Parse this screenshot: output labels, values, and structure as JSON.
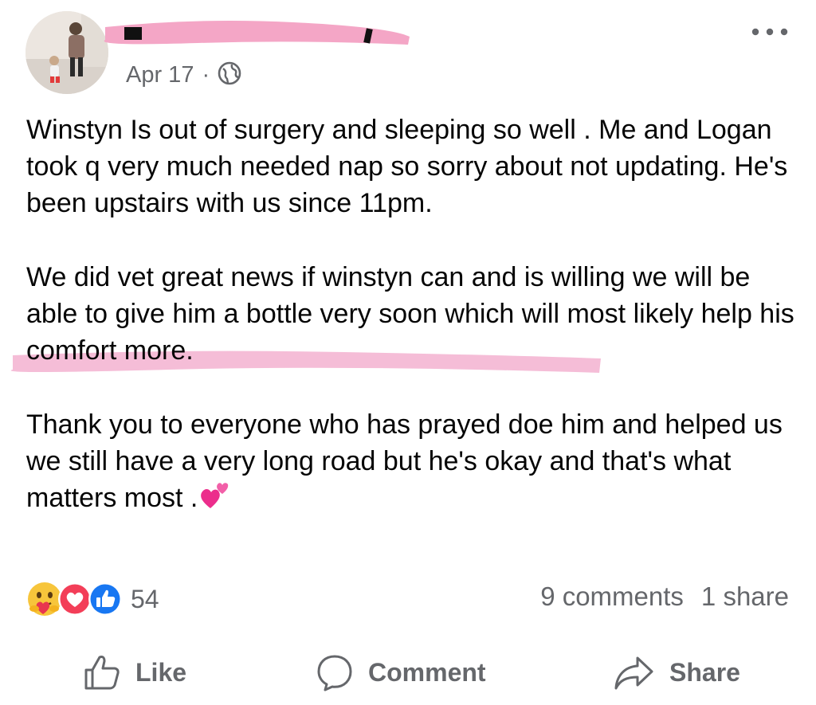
{
  "post": {
    "date": "Apr 17",
    "separator": "·",
    "paragraphs": [
      "Winstyn Is out of surgery and sleeping so well . Me and Logan took q very much needed nap so sorry about not updating.  He's been upstairs with us since 11pm.",
      "We did vet great news if winstyn can and is willing we will be able to give him a bottle very soon which will most likely help his comfort more.",
      "Thank you to everyone who has prayed doe him and helped us we still have a very long road but he's okay and that's what matters most ."
    ]
  },
  "reactions": {
    "count": "54",
    "icons": [
      "care-emoji-icon",
      "love-reaction-icon",
      "like-reaction-icon"
    ]
  },
  "engagement": {
    "comments": "9 comments",
    "shares": "1 share"
  },
  "actions": {
    "like": "Like",
    "comment": "Comment",
    "share": "Share"
  },
  "colors": {
    "secondary_text": "#65676b",
    "like_blue": "#1877f2",
    "love_red": "#f33e58",
    "redaction_pink": "#f4a6c6",
    "highlight_pink": "#f2a7c9"
  }
}
